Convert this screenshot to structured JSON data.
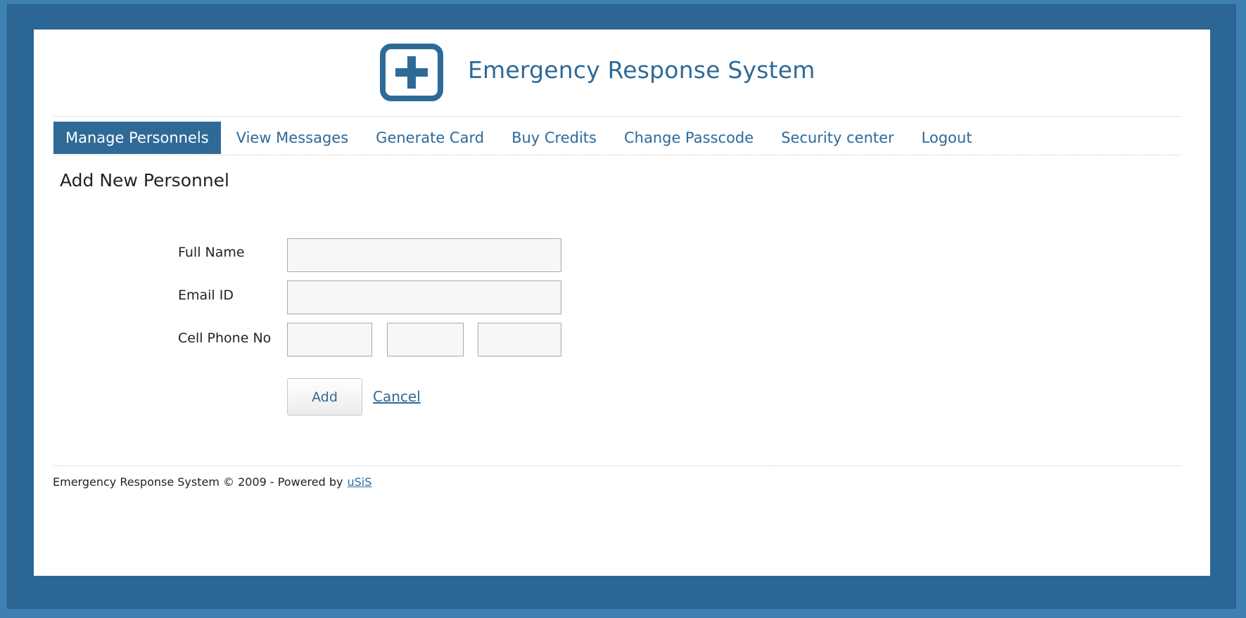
{
  "app": {
    "title": "Emergency Response System",
    "logo_icon": "plus-icon"
  },
  "nav": {
    "items": [
      {
        "label": "Manage Personnels",
        "active": true
      },
      {
        "label": "View Messages",
        "active": false
      },
      {
        "label": "Generate Card",
        "active": false
      },
      {
        "label": "Buy Credits",
        "active": false
      },
      {
        "label": "Change Passcode",
        "active": false
      },
      {
        "label": "Security center",
        "active": false
      },
      {
        "label": "Logout",
        "active": false
      }
    ]
  },
  "page": {
    "title": "Add New Personnel"
  },
  "form": {
    "full_name_label": "Full Name",
    "full_name_value": "",
    "email_label": "Email ID",
    "email_value": "",
    "phone_label": "Cell Phone No",
    "phone_values": [
      "",
      "",
      ""
    ],
    "add_label": "Add",
    "cancel_label": "Cancel"
  },
  "footer": {
    "text": "Emergency Response System © 2009 - Powered by",
    "link_label": "uSiS"
  },
  "colors": {
    "brand": "#2e6a98",
    "outer_background": "#3f80b3",
    "frame": "#2c6694",
    "nav_active_background": "#2f6a97"
  }
}
